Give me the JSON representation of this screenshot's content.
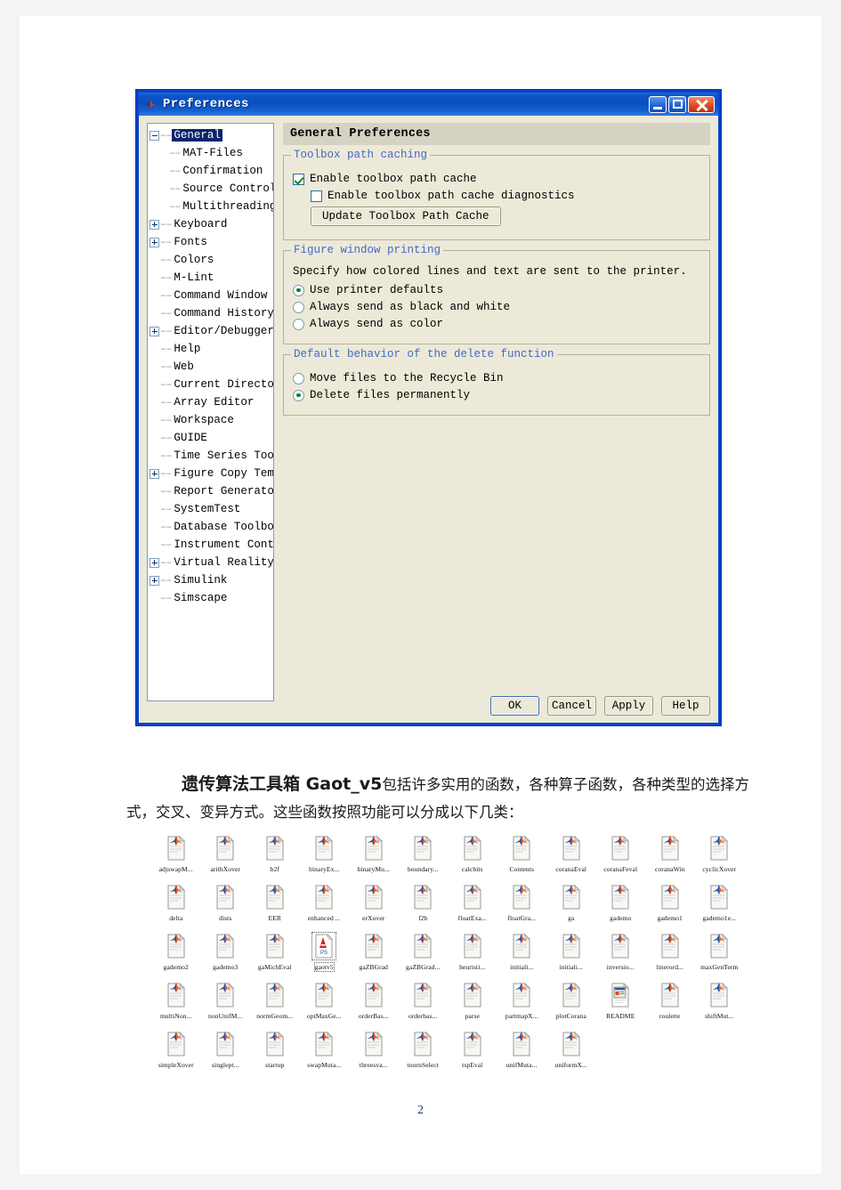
{
  "dialog": {
    "title": "Preferences",
    "title_icon": "matlab-icon",
    "window_controls": {
      "minimize": "minimize-button",
      "maximize": "maximize-button",
      "close": "close-button"
    },
    "tree": [
      {
        "label": "General",
        "depth": 0,
        "expander": "minus",
        "selected": true
      },
      {
        "label": "MAT-Files",
        "depth": 1,
        "expander": "none",
        "selected": false
      },
      {
        "label": "Confirmation",
        "depth": 1,
        "expander": "none",
        "selected": false
      },
      {
        "label": "Source Control",
        "depth": 1,
        "expander": "none",
        "selected": false
      },
      {
        "label": "Multithreading",
        "depth": 1,
        "expander": "none",
        "selected": false
      },
      {
        "label": "Keyboard",
        "depth": 0,
        "expander": "plus",
        "selected": false
      },
      {
        "label": "Fonts",
        "depth": 0,
        "expander": "plus",
        "selected": false
      },
      {
        "label": "Colors",
        "depth": 0,
        "expander": "none",
        "selected": false
      },
      {
        "label": "M-Lint",
        "depth": 0,
        "expander": "none",
        "selected": false
      },
      {
        "label": "Command Window",
        "depth": 0,
        "expander": "none",
        "selected": false
      },
      {
        "label": "Command History",
        "depth": 0,
        "expander": "none",
        "selected": false
      },
      {
        "label": "Editor/Debugger",
        "depth": 0,
        "expander": "plus",
        "selected": false
      },
      {
        "label": "Help",
        "depth": 0,
        "expander": "none",
        "selected": false
      },
      {
        "label": "Web",
        "depth": 0,
        "expander": "none",
        "selected": false
      },
      {
        "label": "Current Directory",
        "depth": 0,
        "expander": "none",
        "selected": false
      },
      {
        "label": "Array Editor",
        "depth": 0,
        "expander": "none",
        "selected": false
      },
      {
        "label": "Workspace",
        "depth": 0,
        "expander": "none",
        "selected": false
      },
      {
        "label": "GUIDE",
        "depth": 0,
        "expander": "none",
        "selected": false
      },
      {
        "label": "Time Series Tools",
        "depth": 0,
        "expander": "none",
        "selected": false
      },
      {
        "label": "Figure Copy Template",
        "depth": 0,
        "expander": "plus",
        "selected": false
      },
      {
        "label": "Report Generator",
        "depth": 0,
        "expander": "none",
        "selected": false
      },
      {
        "label": "SystemTest",
        "depth": 0,
        "expander": "none",
        "selected": false
      },
      {
        "label": "Database Toolbox",
        "depth": 0,
        "expander": "none",
        "selected": false
      },
      {
        "label": "Instrument Control",
        "depth": 0,
        "expander": "none",
        "selected": false
      },
      {
        "label": "Virtual Reality",
        "depth": 0,
        "expander": "plus",
        "selected": false
      },
      {
        "label": "Simulink",
        "depth": 0,
        "expander": "plus",
        "selected": false
      },
      {
        "label": "Simscape",
        "depth": 0,
        "expander": "none",
        "selected": false
      }
    ],
    "content": {
      "header": "General Preferences",
      "group_toolbox": {
        "legend": "Toolbox path caching",
        "enable_cache_label": "Enable toolbox path cache",
        "enable_cache_checked": true,
        "enable_diagnostics_label": "Enable toolbox path cache diagnostics",
        "enable_diagnostics_checked": false,
        "update_button": "Update Toolbox Path Cache"
      },
      "group_printing": {
        "legend": "Figure window printing",
        "description": "Specify how colored lines and text are sent to the printer.",
        "options": [
          {
            "label": "Use printer defaults",
            "selected": true
          },
          {
            "label": "Always send as black and white",
            "selected": false
          },
          {
            "label": "Always send as color",
            "selected": false
          }
        ]
      },
      "group_delete": {
        "legend": "Default behavior of the delete function",
        "options": [
          {
            "label": "Move files to the Recycle Bin",
            "selected": false
          },
          {
            "label": "Delete files permanently",
            "selected": true
          }
        ]
      }
    },
    "footer_buttons": [
      {
        "label": "OK",
        "default": true
      },
      {
        "label": "Cancel",
        "default": false
      },
      {
        "label": "Apply",
        "default": false
      },
      {
        "label": "Help",
        "default": false
      }
    ]
  },
  "paragraph": {
    "lead": "遗传算法工具箱 Gaot_v5",
    "rest": "包括许多实用的函数，各种算子函数，各种类型的选择方式，交叉、变异方式。这些函数按照功能可以分成以下几类："
  },
  "icon_grid": {
    "rows": [
      [
        {
          "label": "adjswapM...",
          "type": "m-file",
          "selected": false
        },
        {
          "label": "arithXover",
          "type": "m-file",
          "selected": false
        },
        {
          "label": "b2f",
          "type": "m-file",
          "selected": false
        },
        {
          "label": "binaryEx...",
          "type": "m-file",
          "selected": false
        },
        {
          "label": "binaryMu...",
          "type": "m-file",
          "selected": false
        },
        {
          "label": "boundary...",
          "type": "m-file",
          "selected": false
        },
        {
          "label": "calcbits",
          "type": "m-file",
          "selected": false
        },
        {
          "label": "Contents",
          "type": "m-file",
          "selected": false
        },
        {
          "label": "coranaEval",
          "type": "m-file",
          "selected": false
        },
        {
          "label": "coranaFeval",
          "type": "m-file",
          "selected": false
        },
        {
          "label": "coranaWin",
          "type": "m-file",
          "selected": false
        },
        {
          "label": "cyclicXover",
          "type": "m-file",
          "selected": false
        }
      ],
      [
        {
          "label": "delta",
          "type": "m-file",
          "selected": false
        },
        {
          "label": "dists",
          "type": "m-file",
          "selected": false
        },
        {
          "label": "EER",
          "type": "m-file",
          "selected": false
        },
        {
          "label": "enhanced ...",
          "type": "m-file",
          "selected": false
        },
        {
          "label": "erXover",
          "type": "m-file",
          "selected": false
        },
        {
          "label": "f2b",
          "type": "m-file",
          "selected": false
        },
        {
          "label": "floatExa...",
          "type": "m-file",
          "selected": false
        },
        {
          "label": "floatGra...",
          "type": "m-file",
          "selected": false
        },
        {
          "label": "ga",
          "type": "m-file",
          "selected": false
        },
        {
          "label": "gademo",
          "type": "m-file",
          "selected": false
        },
        {
          "label": "gademo1",
          "type": "m-file",
          "selected": false
        },
        {
          "label": "gademo1e...",
          "type": "m-file",
          "selected": false
        }
      ],
      [
        {
          "label": "gademo2",
          "type": "m-file",
          "selected": false
        },
        {
          "label": "gademo3",
          "type": "m-file",
          "selected": false
        },
        {
          "label": "gaMichEval",
          "type": "m-file",
          "selected": false
        },
        {
          "label": "gaotv5",
          "type": "ps-file",
          "selected": true
        },
        {
          "label": "gaZBGrad",
          "type": "m-file",
          "selected": false
        },
        {
          "label": "gaZBGrad...",
          "type": "m-file",
          "selected": false
        },
        {
          "label": "heuristi...",
          "type": "m-file",
          "selected": false
        },
        {
          "label": "initiali...",
          "type": "m-file",
          "selected": false
        },
        {
          "label": "initiali...",
          "type": "m-file",
          "selected": false
        },
        {
          "label": "inversio...",
          "type": "m-file",
          "selected": false
        },
        {
          "label": "linerord...",
          "type": "m-file",
          "selected": false
        },
        {
          "label": "maxGenTerm",
          "type": "m-file",
          "selected": false
        }
      ],
      [
        {
          "label": "multiNon...",
          "type": "m-file",
          "selected": false
        },
        {
          "label": "nonUnifM...",
          "type": "m-file",
          "selected": false
        },
        {
          "label": "normGeom...",
          "type": "m-file",
          "selected": false
        },
        {
          "label": "optMaxGe...",
          "type": "m-file",
          "selected": false
        },
        {
          "label": "orderBas...",
          "type": "m-file",
          "selected": false
        },
        {
          "label": "orderbas...",
          "type": "m-file",
          "selected": false
        },
        {
          "label": "parse",
          "type": "m-file",
          "selected": false
        },
        {
          "label": "partmapX...",
          "type": "m-file",
          "selected": false
        },
        {
          "label": "plotCorana",
          "type": "m-file",
          "selected": false
        },
        {
          "label": "README",
          "type": "readme-file",
          "selected": false
        },
        {
          "label": "roulette",
          "type": "m-file",
          "selected": false
        },
        {
          "label": "shiftMut...",
          "type": "m-file",
          "selected": false
        }
      ],
      [
        {
          "label": "simpleXover",
          "type": "m-file",
          "selected": false
        },
        {
          "label": "singlept...",
          "type": "m-file",
          "selected": false
        },
        {
          "label": "startup",
          "type": "m-file",
          "selected": false
        },
        {
          "label": "swapMuta...",
          "type": "m-file",
          "selected": false
        },
        {
          "label": "threesva...",
          "type": "m-file",
          "selected": false
        },
        {
          "label": "tournSelect",
          "type": "m-file",
          "selected": false
        },
        {
          "label": "tspEval",
          "type": "m-file",
          "selected": false
        },
        {
          "label": "unifMuta...",
          "type": "m-file",
          "selected": false
        },
        {
          "label": "uniformX...",
          "type": "m-file",
          "selected": false
        }
      ]
    ]
  },
  "page_number": "2"
}
